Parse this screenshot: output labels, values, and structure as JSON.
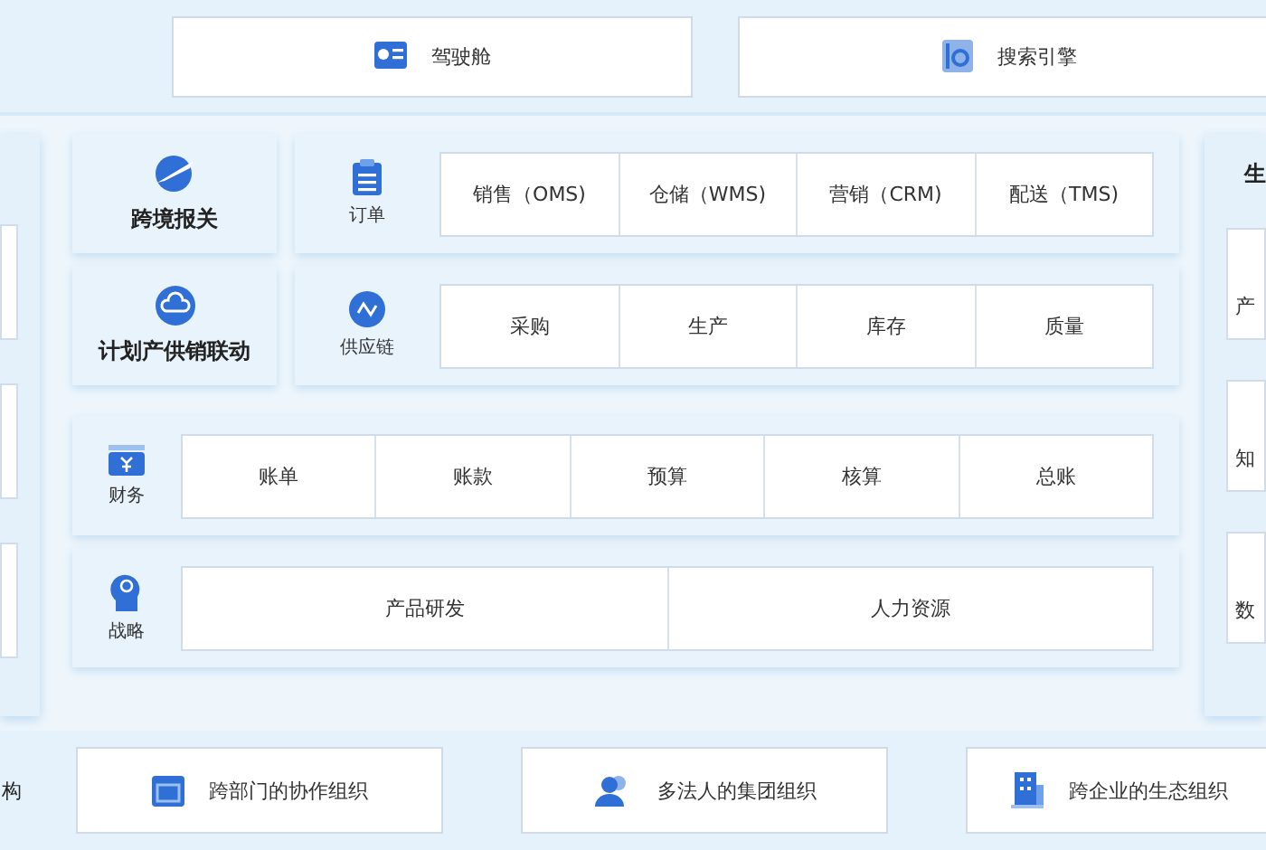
{
  "top_buttons": [
    {
      "label": "驾驶舱",
      "kind": "dashboard"
    },
    {
      "label": "搜索引擎",
      "kind": "search"
    }
  ],
  "rows": [
    {
      "tile": {
        "label": "跨境报关",
        "kind": "plane"
      },
      "group": {
        "label": "订单",
        "kind": "clipboard"
      },
      "cells": [
        "销售（OMS)",
        "仓储（WMS)",
        "营销（CRM)",
        "配送（TMS)"
      ]
    },
    {
      "tile": {
        "label": "计划产供销联动",
        "kind": "cloud"
      },
      "group": {
        "label": "供应链",
        "kind": "nodes"
      },
      "cells": [
        "采购",
        "生产",
        "库存",
        "质量"
      ]
    },
    {
      "group": {
        "label": "财务",
        "kind": "wallet"
      },
      "cells": [
        "账单",
        "账款",
        "预算",
        "核算",
        "总账"
      ]
    },
    {
      "group": {
        "label": "战略",
        "kind": "head"
      },
      "cells": [
        "产品研发",
        "人力资源"
      ]
    }
  ],
  "right_column": {
    "title": "生",
    "cards": [
      "产",
      "知",
      "数"
    ]
  },
  "bottom": {
    "label": "构",
    "buttons": [
      {
        "label": "跨部门的协作组织",
        "kind": "window"
      },
      {
        "label": "多法人的集团组织",
        "kind": "people"
      },
      {
        "label": "跨企业的生态组织",
        "kind": "building"
      }
    ]
  }
}
